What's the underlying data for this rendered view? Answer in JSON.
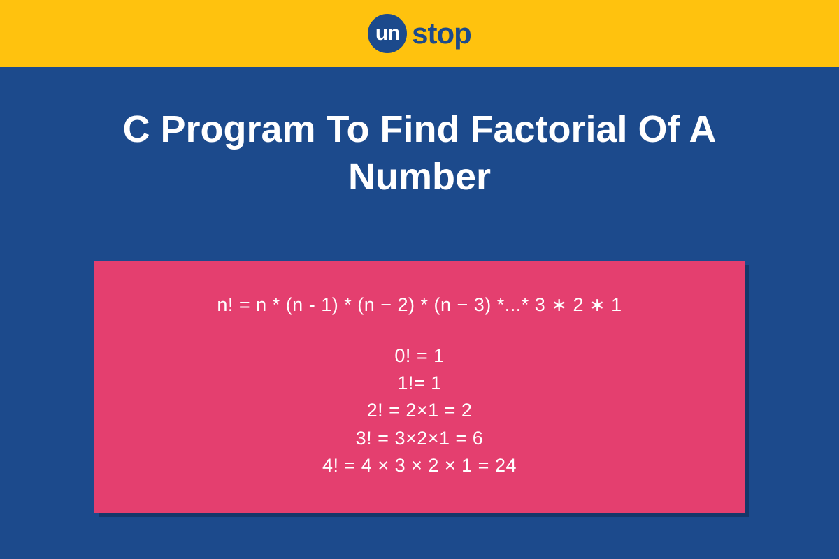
{
  "logo": {
    "circle_text": "un",
    "suffix_text": "stop"
  },
  "title": "C Program To Find Factorial Of A Number",
  "formula": {
    "main": "n! = n * (n - 1) * (n − 2) * (n − 3) *...* 3 ∗ 2 ∗ 1",
    "examples": [
      "0! = 1",
      "1!= 1",
      "2! = 2×1 = 2",
      "3! = 3×2×1 = 6",
      "4! = 4 × 3 × 2 × 1 = 24"
    ]
  },
  "colors": {
    "yellow": "#FFC20E",
    "blue": "#1C4A8C",
    "pink": "#E43F6F",
    "white": "#FFFFFF"
  }
}
